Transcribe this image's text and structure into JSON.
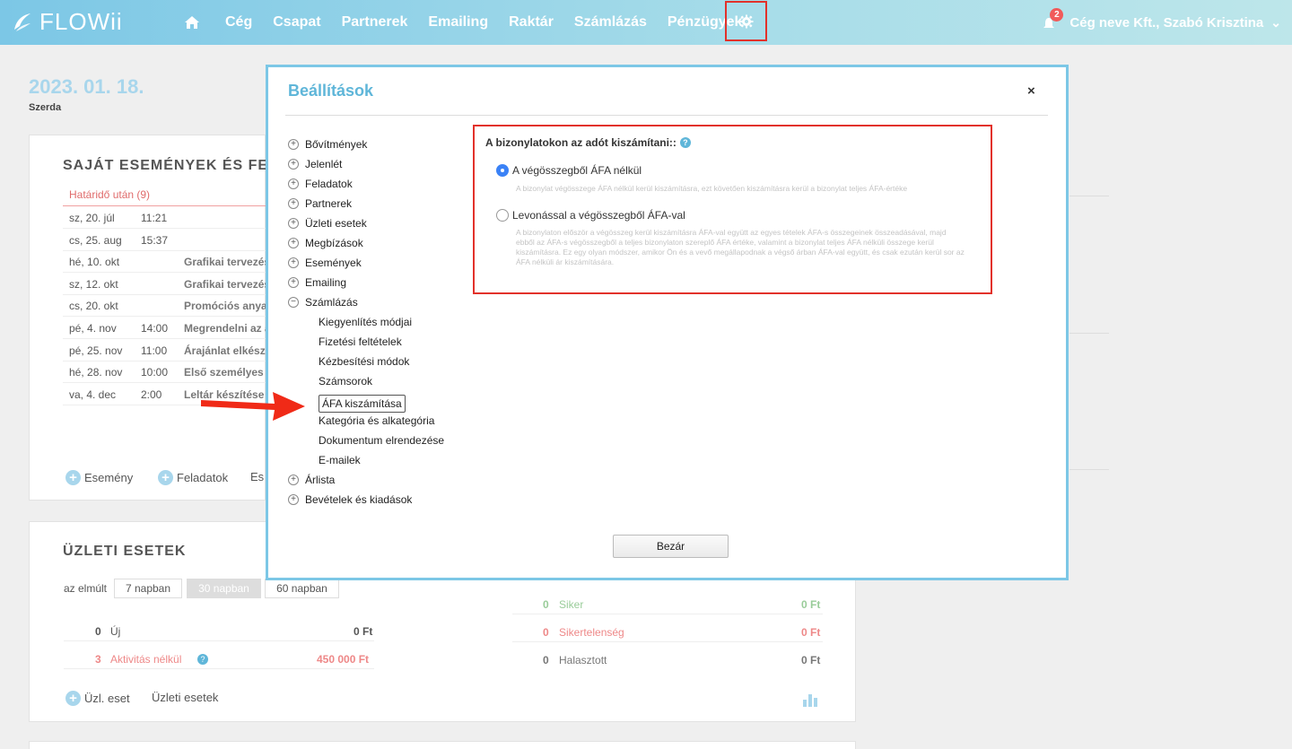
{
  "app": {
    "logo": "FLOWii"
  },
  "nav": {
    "items": [
      "Cég",
      "Csapat",
      "Partnerek",
      "Emailing",
      "Raktár",
      "Számlázás",
      "Pénzügyek"
    ],
    "notification_count": "2",
    "user": "Cég neve Kft., Szabó Krisztina"
  },
  "dashboard": {
    "date": "2023. 01. 18.",
    "weekday": "Szerda",
    "events_title": "SAJÁT ESEMÉNYEK ÉS FELA",
    "overdue_label": "Határidő után (9)",
    "events": [
      {
        "date": "sz, 20. júl",
        "time": "11:21",
        "name": ""
      },
      {
        "date": "cs, 25. aug",
        "time": "15:37",
        "name": ""
      },
      {
        "date": "hé, 10. okt",
        "time": "",
        "name": "Grafikai tervezés"
      },
      {
        "date": "sz, 12. okt",
        "time": "",
        "name": "Grafikai tervezés"
      },
      {
        "date": "cs, 20. okt",
        "time": "",
        "name": "Promóciós anyag"
      },
      {
        "date": "pé, 4. nov",
        "time": "14:00",
        "name": "Megrendelni az a"
      },
      {
        "date": "pé, 25. nov",
        "time": "11:00",
        "name": "Árajánlat elkészí"
      },
      {
        "date": "hé, 28. nov",
        "time": "10:00",
        "name": "Első személyes t"
      },
      {
        "date": "va, 4. dec",
        "time": "2:00",
        "name": "Leltár készítése"
      }
    ],
    "add_event": "Esemény",
    "add_task": "Feladatok",
    "add_more": "Es",
    "deals_title": "ÜZLETI ESETEK",
    "period_label": "az elmúlt",
    "periods": [
      "7 napban",
      "30 napban",
      "60 napban"
    ],
    "stats_left": [
      {
        "count": "0",
        "label": "Új",
        "amount": "0 Ft"
      },
      {
        "count": "3",
        "label": "Aktivitás nélkül",
        "amount": "450 000 Ft"
      }
    ],
    "stats_right": [
      {
        "count": "0",
        "label": "Siker",
        "amount": "0 Ft"
      },
      {
        "count": "0",
        "label": "Sikertelenség",
        "amount": "0 Ft"
      },
      {
        "count": "0",
        "label": "Halasztott",
        "amount": "0 Ft"
      }
    ],
    "add_deal": "Üzl. eset",
    "deals_link": "Üzleti esetek"
  },
  "modal": {
    "title": "Beállítások",
    "close": "×",
    "tree": {
      "top": [
        "Bővítmények",
        "Jelenlét",
        "Feladatok",
        "Partnerek",
        "Üzleti esetek",
        "Megbízások",
        "Események",
        "Emailing"
      ],
      "open": "Számlázás",
      "children": [
        "Kiegyenlítés módjai",
        "Fizetési feltételek",
        "Kézbesítési módok",
        "Számsorok",
        "ÁFA kiszámítása",
        "Kategória és alkategória",
        "Dokumentum elrendezése",
        "E-mailek"
      ],
      "bottom": [
        "Árlista",
        "Bevételek és kiadások"
      ]
    },
    "question": "A bizonylatokon az adót kiszámítani::",
    "options": [
      {
        "label": "A végösszegből ÁFA nélkül",
        "selected": true,
        "desc": "A bizonylat végösszege ÁFA nélkül kerül kiszámításra, ezt követően kiszámításra kerül a bizonylat teljes ÁFA-értéke"
      },
      {
        "label": "Levonással a végösszegből ÁFA-val",
        "selected": false,
        "desc": "A bizonylaton először a végösszeg kerül kiszámításra ÁFA-val együtt az egyes tételek ÁFA-s összegeinek összeadásával, majd ebből az ÁFA-s végösszegből a teljes bizonylaton szereplő ÁFA értéke, valamint a bizonylat teljes ÁFA nélküli összege kerül kiszámításra. Ez egy olyan módszer, amikor Ön és a vevő megállapodnak a végső árban ÁFA-val együtt, és csak ezután kerül sor az ÁFA nélküli ár kiszámítására."
      }
    ],
    "close_button": "Bezár"
  },
  "colors": {
    "accent": "#5fb6d9",
    "highlight": "#e2312a",
    "header_from": "#7cc7e6",
    "header_to": "#bde6ea"
  }
}
